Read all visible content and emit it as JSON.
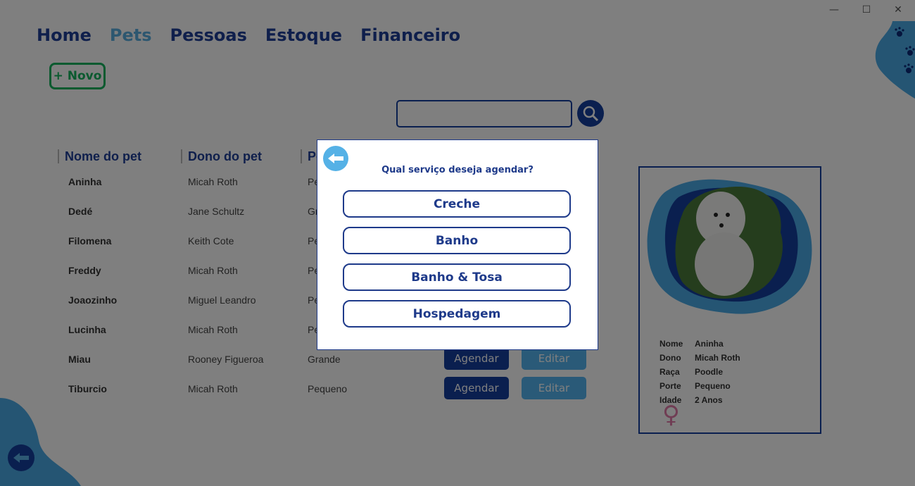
{
  "window": {
    "minimize": "—",
    "maximize": "☐",
    "close": "✕"
  },
  "nav": [
    "Home",
    "Pets",
    "Pessoas",
    "Estoque",
    "Financeiro"
  ],
  "novo_label": "+ Novo",
  "search": {
    "value": ""
  },
  "table": {
    "headers": [
      "Nome do pet",
      "Dono do pet",
      "Porte"
    ],
    "rows": [
      {
        "name": "Aninha",
        "owner": "Micah Roth",
        "size": "Pequeno"
      },
      {
        "name": "Dedé",
        "owner": "Jane Schultz",
        "size": "Grande"
      },
      {
        "name": "Filomena",
        "owner": "Keith Cote",
        "size": "Pequeno"
      },
      {
        "name": "Freddy",
        "owner": "Micah Roth",
        "size": "Pequeno"
      },
      {
        "name": "Joaozinho",
        "owner": "Miguel Leandro",
        "size": "Pequeno"
      },
      {
        "name": "Lucinha",
        "owner": "Micah Roth",
        "size": "Pequeno"
      },
      {
        "name": "Miau",
        "owner": "Rooney Figueroa",
        "size": "Grande"
      },
      {
        "name": "Tiburcio",
        "owner": "Micah Roth",
        "size": "Pequeno"
      }
    ],
    "agendar_label": "Agendar",
    "editar_label": "Editar"
  },
  "card": {
    "fields": [
      {
        "k": "Nome",
        "v": "Aninha"
      },
      {
        "k": "Dono",
        "v": "Micah Roth"
      },
      {
        "k": "Raça",
        "v": "Poodle"
      },
      {
        "k": "Porte",
        "v": "Pequeno"
      },
      {
        "k": "Idade",
        "v": "2 Anos"
      }
    ],
    "gender": "♀"
  },
  "modal": {
    "title": "Qual serviço deseja agendar?",
    "options": [
      "Creche",
      "Banho",
      "Banho & Tosa",
      "Hospedagem"
    ]
  }
}
